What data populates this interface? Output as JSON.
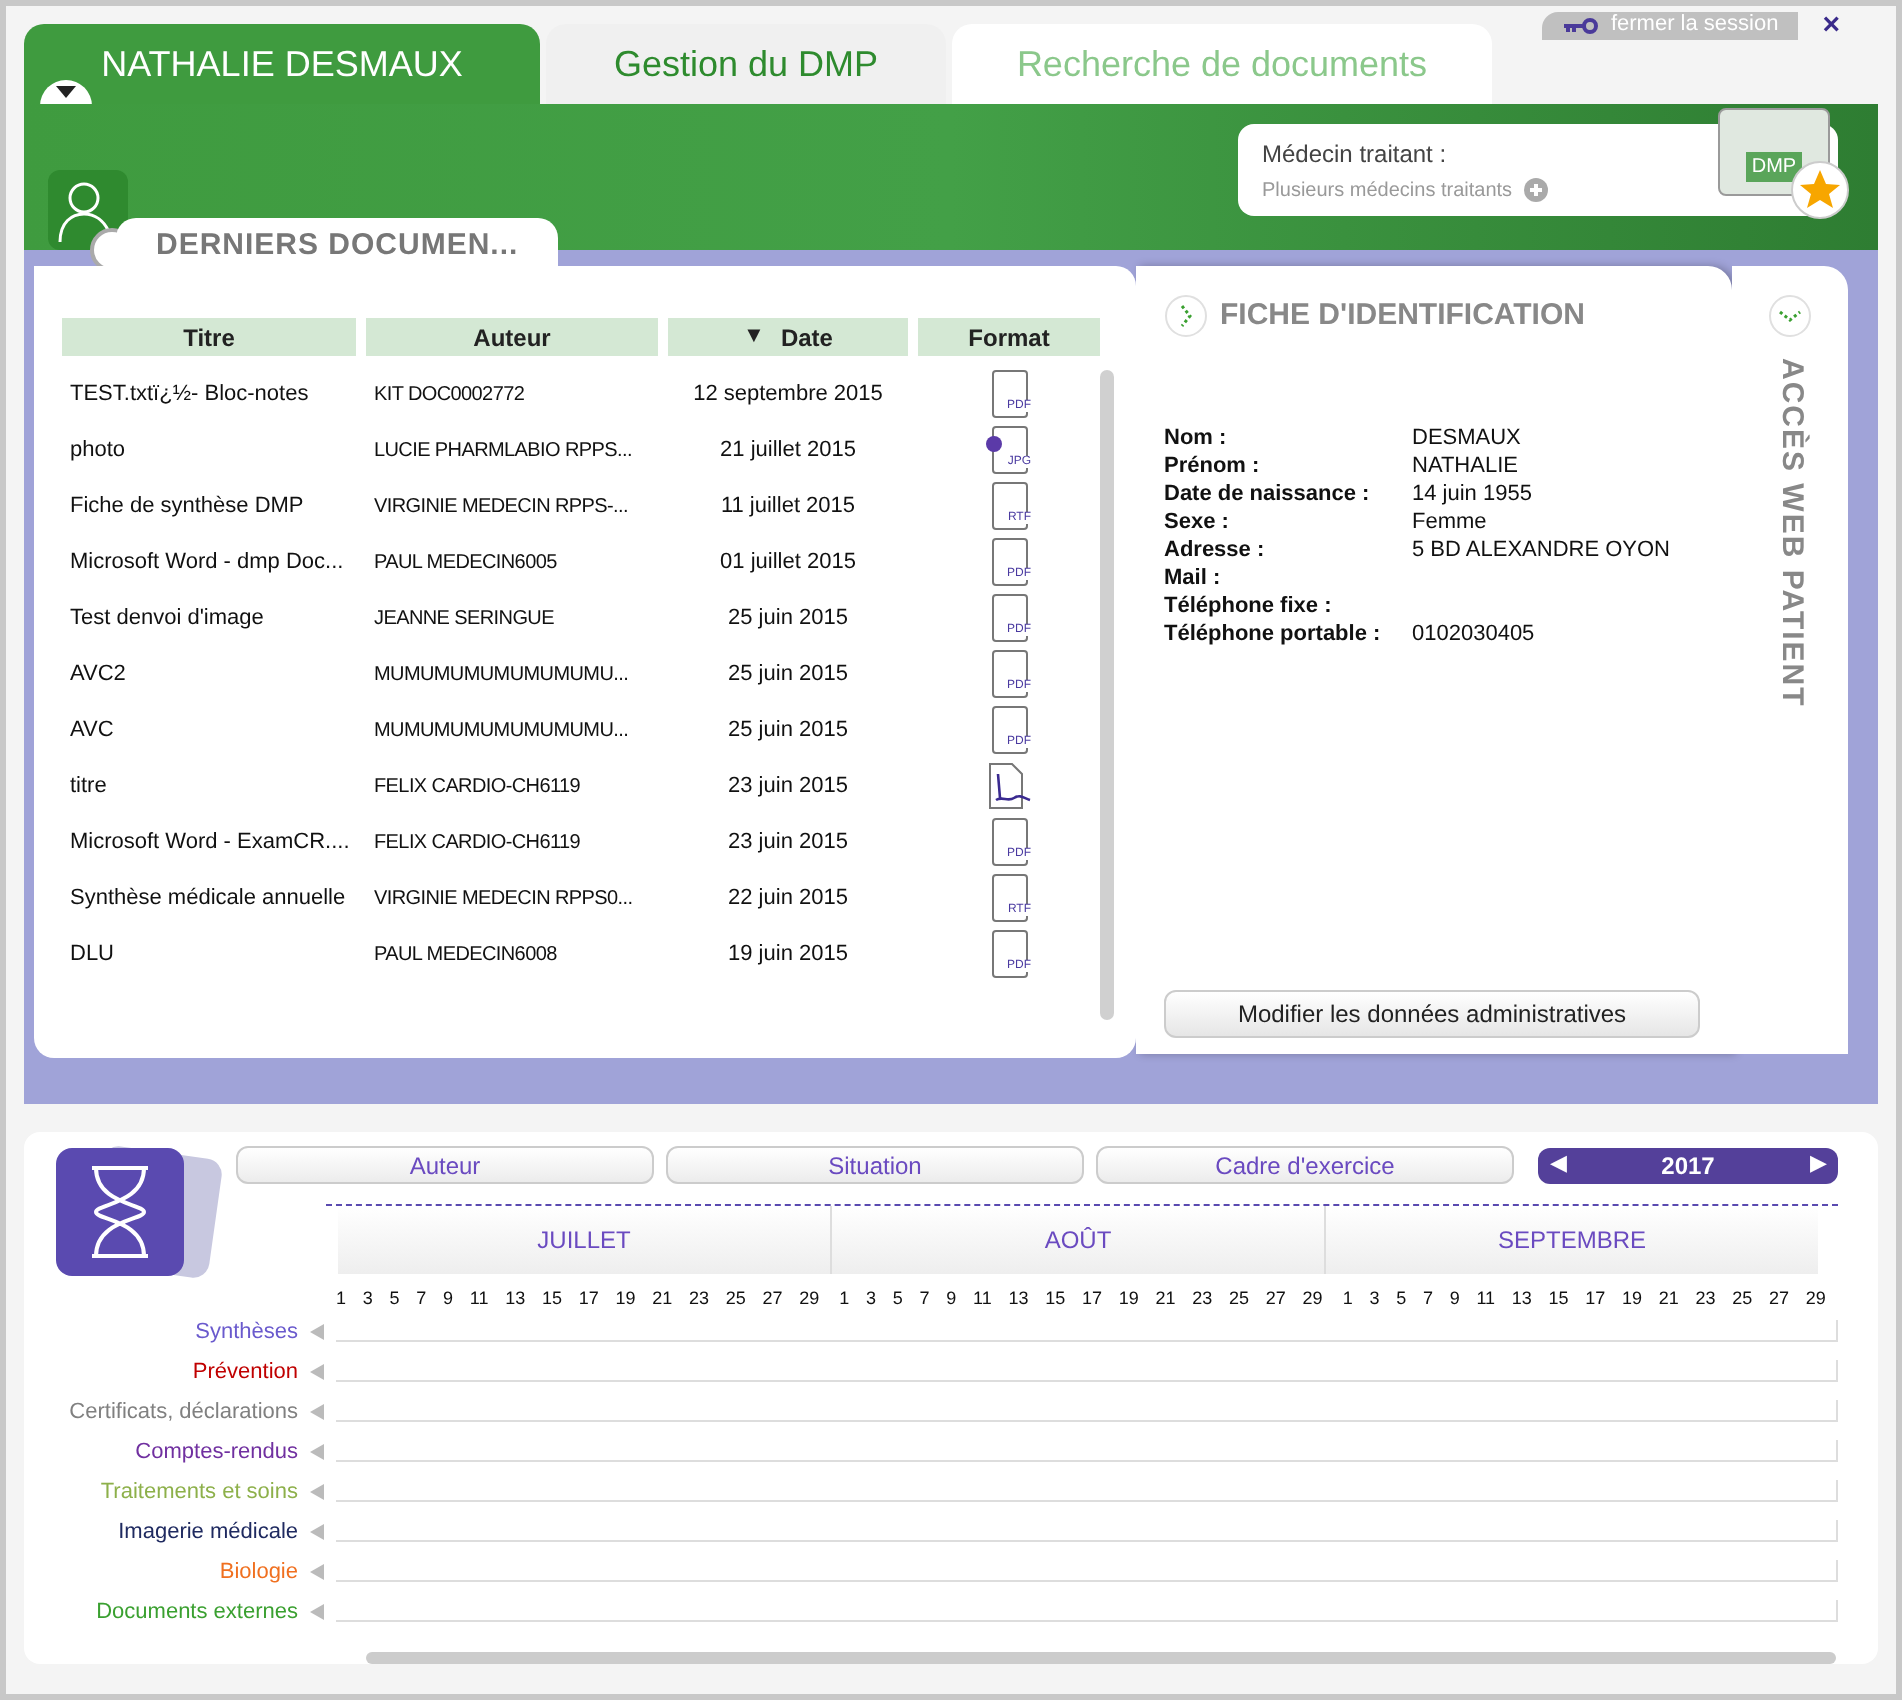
{
  "session": {
    "logout": "fermer la session",
    "close": "×"
  },
  "tabs": [
    {
      "label": "NATHALIE DESMAUX",
      "selected": true
    },
    {
      "label": "Gestion du DMP",
      "selected": false
    },
    {
      "label": "Recherche de documents",
      "selected": false
    }
  ],
  "doctor_card": {
    "title": "Médecin traitant :",
    "subtitle": "Plusieurs médecins traitants",
    "logo": "DMP"
  },
  "documents": {
    "title": "DERNIERS DOCUMEN...",
    "columns": [
      {
        "label": "Titre"
      },
      {
        "label": "Auteur"
      },
      {
        "label": "Date",
        "sort": "▼"
      },
      {
        "label": "Format"
      }
    ],
    "rows": [
      {
        "title": "TEST.txtï¿½- Bloc-notes",
        "author": "KIT DOC0002772",
        "date": "12 septembre 2015",
        "format": {
          "kind": "file",
          "label": "PDF"
        }
      },
      {
        "title": "photo",
        "author": "LUCIE PHARMLABIO RPPS...",
        "date": "21 juillet 2015",
        "format": {
          "kind": "image",
          "label": "JPG"
        }
      },
      {
        "title": "Fiche de synthèse DMP",
        "author": "VIRGINIE MEDECIN RPPS-...",
        "date": "11 juillet 2015",
        "format": {
          "kind": "file",
          "label": "RTF"
        }
      },
      {
        "title": "Microsoft Word - dmp Doc...",
        "author": "PAUL MEDECIN6005",
        "date": "01 juillet 2015",
        "format": {
          "kind": "file",
          "label": "PDF"
        }
      },
      {
        "title": "Test denvoi d'image",
        "author": "JEANNE SERINGUE",
        "date": "25 juin 2015",
        "format": {
          "kind": "file",
          "label": "PDF"
        }
      },
      {
        "title": "AVC2",
        "author": "MUMUMUMUMUMUMUMU...",
        "date": "25 juin 2015",
        "format": {
          "kind": "file",
          "label": "PDF"
        }
      },
      {
        "title": "AVC",
        "author": "MUMUMUMUMUMUMUMU...",
        "date": "25 juin 2015",
        "format": {
          "kind": "file",
          "label": "PDF"
        }
      },
      {
        "title": "titre",
        "author": "FELIX CARDIO-CH6119",
        "date": "23 juin 2015",
        "format": {
          "kind": "signature"
        }
      },
      {
        "title": "Microsoft Word - ExamCR....",
        "author": "FELIX CARDIO-CH6119",
        "date": "23 juin 2015",
        "format": {
          "kind": "file",
          "label": "PDF"
        }
      },
      {
        "title": "Synthèse médicale annuelle",
        "author": "VIRGINIE MEDECIN RPPS0...",
        "date": "22 juin 2015",
        "format": {
          "kind": "file",
          "label": "RTF"
        }
      },
      {
        "title": "DLU",
        "author": "PAUL MEDECIN6008",
        "date": "19 juin 2015",
        "format": {
          "kind": "file",
          "label": "PDF"
        }
      }
    ]
  },
  "identity": {
    "title": "FICHE D'IDENTIFICATION",
    "fields": [
      {
        "label": "Nom :",
        "value": "DESMAUX"
      },
      {
        "label": "Prénom :",
        "value": "NATHALIE"
      },
      {
        "label": "Date de naissance :",
        "value": "14 juin 1955"
      },
      {
        "label": "Sexe :",
        "value": "Femme"
      },
      {
        "label": "Adresse :",
        "value": "5 BD ALEXANDRE OYON"
      },
      {
        "label": "Mail :"
      },
      {
        "label": "Téléphone fixe :"
      },
      {
        "label": "Téléphone portable :",
        "value": "0102030405"
      }
    ],
    "button": "Modifier les données administratives"
  },
  "side_tab": {
    "label": "ACCÈS WEB PATIENT"
  },
  "timeline": {
    "filters": [
      "Auteur",
      "Situation",
      "Cadre d'exercice"
    ],
    "year": {
      "prev": "◀",
      "label": "2017",
      "next": "▶"
    },
    "months": [
      {
        "label": "JUILLET",
        "days": [
          "1",
          "3",
          "5",
          "7",
          "9",
          "11",
          "13",
          "15",
          "17",
          "19",
          "21",
          "23",
          "25",
          "27",
          "29"
        ]
      },
      {
        "label": "AOÛT",
        "days": [
          "1",
          "3",
          "5",
          "7",
          "9",
          "11",
          "13",
          "15",
          "17",
          "19",
          "21",
          "23",
          "25",
          "27",
          "29"
        ]
      },
      {
        "label": "SEPTEMBRE",
        "days": [
          "1",
          "3",
          "5",
          "7",
          "9",
          "11",
          "13",
          "15",
          "17",
          "19",
          "21",
          "23",
          "25",
          "27",
          "29"
        ]
      }
    ],
    "categories": [
      {
        "label": "Synthèses",
        "color": "#6a5acd"
      },
      {
        "label": "Prévention",
        "color": "#c00000"
      },
      {
        "label": "Certificats, déclarations",
        "color": "#808080"
      },
      {
        "label": "Comptes-rendus",
        "color": "#7030a0"
      },
      {
        "label": "Traitements et soins",
        "color": "#8db04a"
      },
      {
        "label": "Imagerie médicale",
        "color": "#1f2a60"
      },
      {
        "label": "Biologie",
        "color": "#f07020"
      },
      {
        "label": "Documents externes",
        "color": "#3aa030"
      }
    ]
  }
}
